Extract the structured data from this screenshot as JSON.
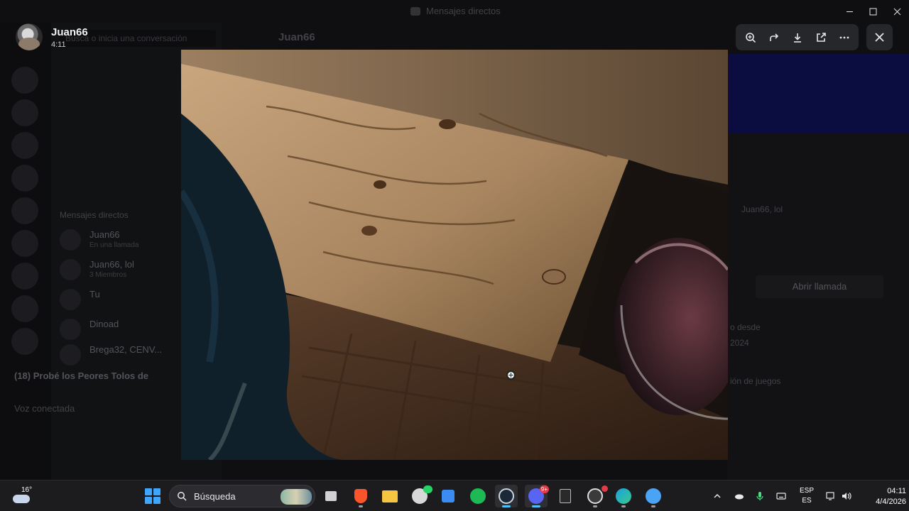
{
  "window": {
    "title": "Mensajes directos"
  },
  "background_app": {
    "search_placeholder": "Busca o inicia una conversación",
    "chat_header_name": "Juan66",
    "section_label": "Mensajes directos",
    "dm_items": [
      {
        "name": "Juan66",
        "sub": "En una llamada"
      },
      {
        "name": "Juan66, lol",
        "sub": "3 Miembros"
      },
      {
        "name": "Tu",
        "sub": ""
      },
      {
        "name": "Dinoad",
        "sub": ""
      },
      {
        "name": "Brega32, CENV...",
        "sub": ""
      }
    ],
    "notification": "(18) Probé los Peores Tolos de",
    "user_status": "Voz conectada",
    "right_panel": {
      "name": "Juan66",
      "group_line": "Juan66, lol",
      "open_call_label": "Abrir llamada",
      "member_since_label": "o desde",
      "member_since_value": "2024",
      "games_label": "ión de juegos"
    }
  },
  "viewer": {
    "user_name": "Juan66",
    "time": "4:11",
    "toolbar": [
      {
        "name": "zoom-in",
        "icon": "zoom-in-icon"
      },
      {
        "name": "forward",
        "icon": "forward-icon"
      },
      {
        "name": "download",
        "icon": "download-icon"
      },
      {
        "name": "open-in-browser",
        "icon": "external-link-icon"
      },
      {
        "name": "more-options",
        "icon": "more-horizontal-icon"
      }
    ],
    "close_icon": "close-icon"
  },
  "taskbar": {
    "weather_temp": "16°",
    "search_label": "Búsqueda",
    "apps": [
      {
        "name": "task-view",
        "color": "#d0d0d5"
      },
      {
        "name": "brave",
        "color": "#fb542b"
      },
      {
        "name": "file-explorer",
        "color": "#f5c542"
      },
      {
        "name": "whatsapp-like",
        "color": "#25d366",
        "badge": ""
      },
      {
        "name": "microsoft-store",
        "color": "#3b8cf2"
      },
      {
        "name": "spotify",
        "color": "#1db954"
      },
      {
        "name": "steam",
        "color": "#1b2838",
        "active": true
      },
      {
        "name": "discord",
        "color": "#5865f2",
        "badge": "9+",
        "active": true
      },
      {
        "name": "epic-games",
        "color": "#2a2a2a"
      },
      {
        "name": "obs",
        "color": "#3a3a3a"
      },
      {
        "name": "edge",
        "color": "#1ba1e2"
      },
      {
        "name": "webcam-app",
        "color": "#4ba3f5"
      }
    ],
    "tray": {
      "language_top": "ESP",
      "language_bottom": "ES",
      "time": "04:11",
      "date": "4/4/2026"
    }
  }
}
